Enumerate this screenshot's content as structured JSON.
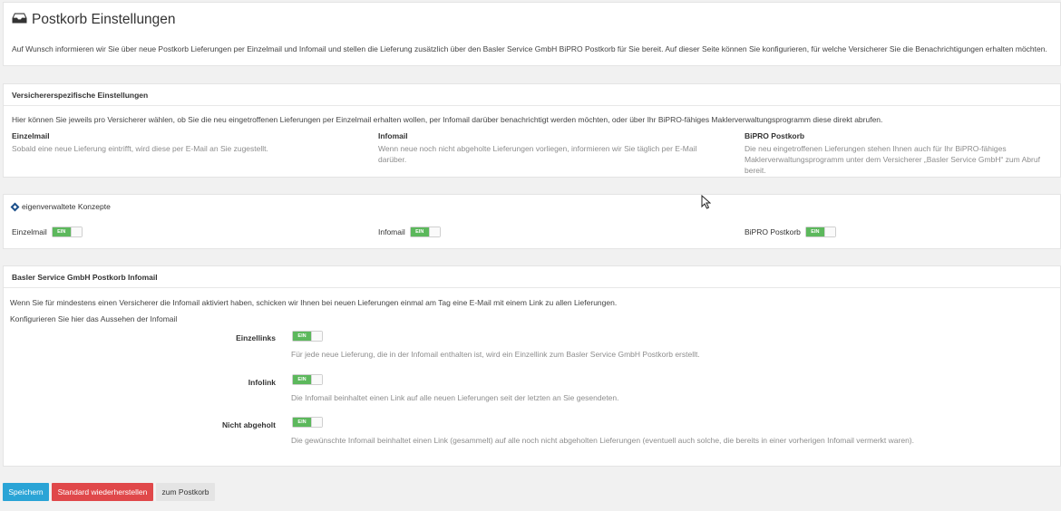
{
  "header": {
    "title": "Postkorb Einstellungen",
    "icon": "inbox-icon",
    "intro": "Auf Wunsch informieren wir Sie über neue Postkorb Lieferungen per Einzelmail und Infomail und stellen die Lieferung zusätzlich über den Basler Service GmbH BiPRO Postkorb für Sie bereit. Auf dieser Seite können Sie konfigurieren, für welche Versicherer Sie die Benachrichtigungen erhalten möchten."
  },
  "versicherer": {
    "heading": "Versichererspezifische Einstellungen",
    "text": "Hier können Sie jeweils pro Versicherer wählen, ob Sie die neu eingetroffenen Lieferungen per Einzelmail erhalten wollen, per Infomail darüber benachrichtigt werden möchten, oder über Ihr BiPRO-fähiges Maklerverwaltungsprogramm diese direkt abrufen.",
    "columns": [
      {
        "title": "Einzelmail",
        "desc": "Sobald eine neue Lieferung eintrifft, wird diese per E-Mail an Sie zugestellt."
      },
      {
        "title": "Infomail",
        "desc": "Wenn neue noch nicht abgeholte Lieferungen vorliegen, informieren wir Sie täglich per E-Mail darüber."
      },
      {
        "title": "BiPRO Postkorb",
        "desc": "Die neu eingetroffenen Lieferungen stehen Ihnen auch für Ihr BiPRO-fähiges Maklerverwaltungsprogramm unter dem Versicherer „Basler Service GmbH“ zum Abruf bereit."
      }
    ]
  },
  "konzepte": {
    "heading": "eigenverwaltete Konzepte",
    "icon": "diamond-icon",
    "toggles": [
      {
        "label": "Einzelmail",
        "state": "EIN"
      },
      {
        "label": "Infomail",
        "state": "EIN"
      },
      {
        "label": "BiPRO Postkorb",
        "state": "EIN"
      }
    ]
  },
  "infomail": {
    "heading": "Basler Service GmbH Postkorb Infomail",
    "text1": "Wenn Sie für mindestens einen Versicherer die Infomail aktiviert haben, schicken wir Ihnen bei neuen Lieferungen einmal am Tag eine E-Mail mit einem Link zu allen Lieferungen.",
    "text2": "Konfigurieren Sie hier das Aussehen der Infomail",
    "options": [
      {
        "label": "Einzellinks",
        "state": "EIN",
        "desc": "Für jede neue Lieferung, die in der Infomail enthalten ist, wird ein Einzellink zum Basler Service GmbH Postkorb erstellt."
      },
      {
        "label": "Infolink",
        "state": "EIN",
        "desc": "Die Infomail beinhaltet einen Link auf alle neuen Lieferungen seit der letzten an Sie gesendeten."
      },
      {
        "label": "Nicht abgeholt",
        "state": "EIN",
        "desc": "Die gewünschte Infomail beinhaltet einen Link (gesammelt) auf alle noch nicht abgeholten Lieferungen (eventuell auch solche, die bereits in einer vorherigen Infomail vermerkt waren)."
      }
    ]
  },
  "buttons": {
    "save": "Speichern",
    "reset": "Standard wiederherstellen",
    "postkorb": "zum Postkorb"
  },
  "colors": {
    "primary": "#2aa4d6",
    "danger": "#e0484a",
    "toggle_on": "#5cb85c"
  }
}
